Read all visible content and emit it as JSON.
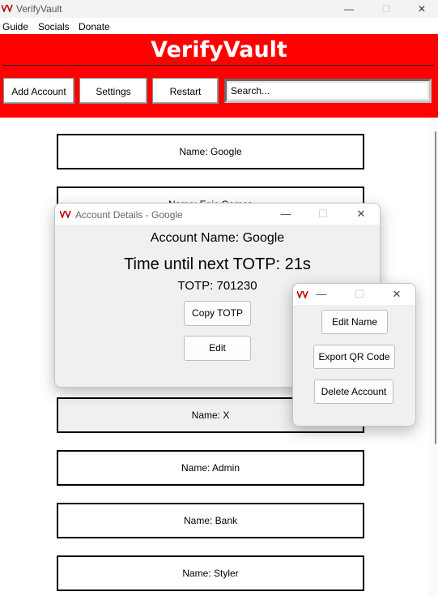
{
  "window": {
    "title": "VerifyVault",
    "controls": {
      "minimize": "—",
      "maximize": "☐",
      "close": "✕"
    }
  },
  "menu": [
    "Guide",
    "Socials",
    "Donate"
  ],
  "header": {
    "title": "VerifyVault",
    "buttons": {
      "add_account": "Add Account",
      "settings": "Settings",
      "restart": "Restart"
    },
    "search": {
      "placeholder": "Search...",
      "value": ""
    }
  },
  "accounts": [
    "Name: Google",
    "Name: Epic Games",
    "Name: X",
    "Name: Admin",
    "Name: Bank",
    "Name: Styler"
  ],
  "account_details": {
    "title": "Account Details - Google",
    "account_name": "Account Name: Google",
    "countdown": "Time until next TOTP: 21s",
    "totp": "TOTP: 701230",
    "copy_button": "Copy TOTP",
    "edit_button": "Edit"
  },
  "edit_menu": {
    "edit_name": "Edit Name",
    "export_qr": "Export QR Code",
    "delete": "Delete Account"
  },
  "colors": {
    "header_bg": "#ff0000",
    "header_text": "#ffffff",
    "dialog_bg": "#f0f0f0"
  }
}
